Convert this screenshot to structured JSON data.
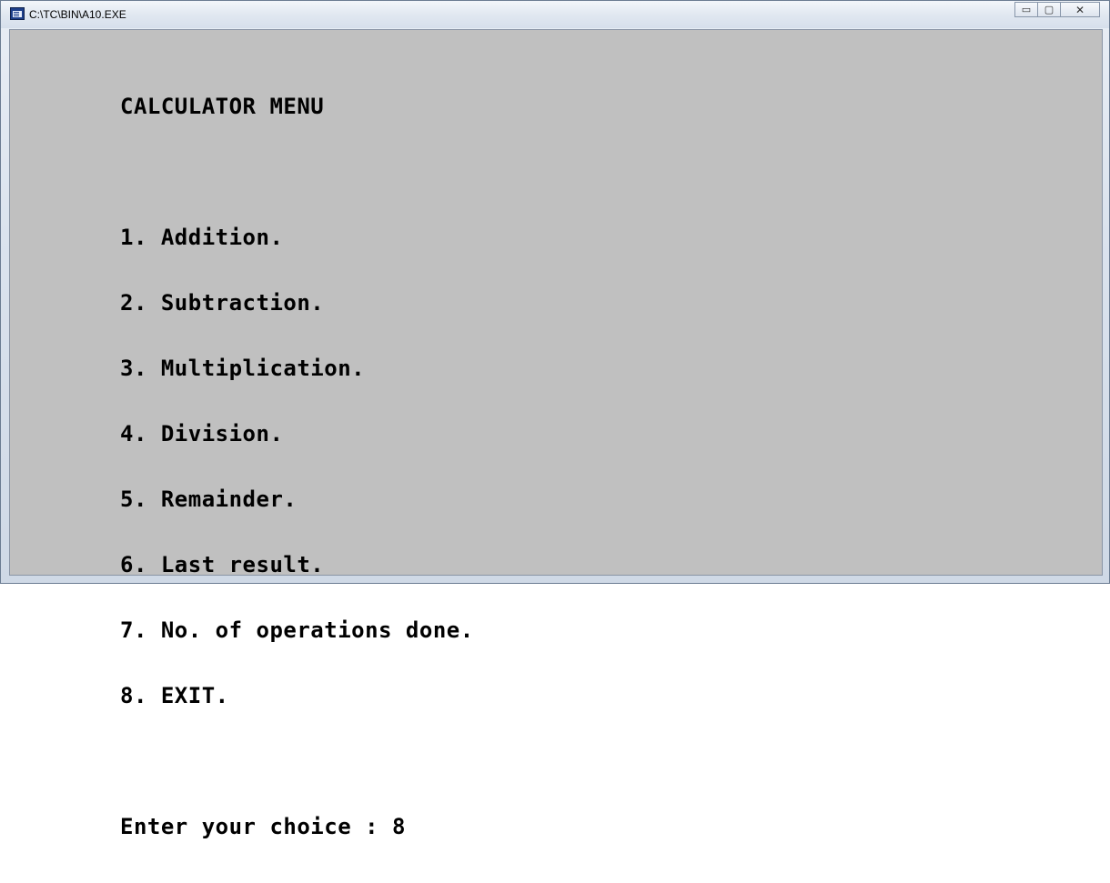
{
  "window": {
    "title": "C:\\TC\\BIN\\A10.EXE",
    "controls": {
      "minimize": "▭",
      "maximize": "▢",
      "close": "✕"
    }
  },
  "console": {
    "heading": "CALCULATOR MENU",
    "menu_items": [
      "1. Addition.",
      "2. Subtraction.",
      "3. Multiplication.",
      "4. Division.",
      "5. Remainder.",
      "6. Last result.",
      "7. No. of operations done.",
      "8. EXIT."
    ],
    "prompt": "Enter your choice : 8"
  }
}
